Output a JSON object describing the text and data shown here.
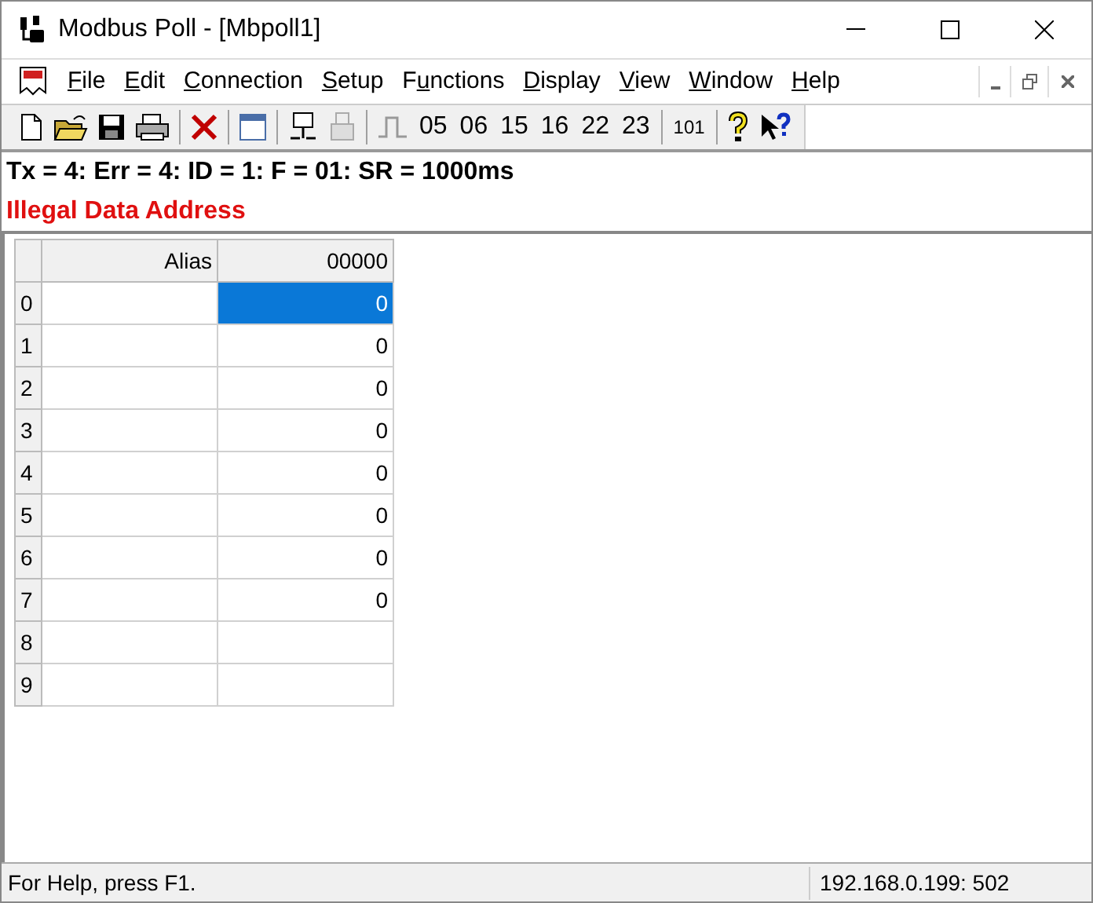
{
  "window": {
    "title": "Modbus Poll - [Mbpoll1]"
  },
  "menu": [
    {
      "access_key": "F",
      "after": "ile"
    },
    {
      "access_key": "E",
      "after": "dit"
    },
    {
      "access_key": "C",
      "after": "onnection"
    },
    {
      "access_key": "S",
      "after": "etup"
    },
    {
      "before": "F",
      "access_key": "u",
      "after": "nctions"
    },
    {
      "access_key": "D",
      "after": "isplay"
    },
    {
      "access_key": "V",
      "after": "iew"
    },
    {
      "access_key": "W",
      "after": "indow"
    },
    {
      "access_key": "H",
      "after": "elp"
    }
  ],
  "toolbar": [
    {
      "kind": "new"
    },
    {
      "kind": "open"
    },
    {
      "kind": "save"
    },
    {
      "kind": "print"
    },
    {
      "kind": "sep"
    },
    {
      "kind": "disconnect"
    },
    {
      "kind": "sep"
    },
    {
      "kind": "window"
    },
    {
      "kind": "sep"
    },
    {
      "kind": "connect"
    },
    {
      "kind": "connect_disabled"
    },
    {
      "kind": "sep"
    },
    {
      "kind": "pulse"
    },
    {
      "kind": "text",
      "label": "05"
    },
    {
      "kind": "text",
      "label": "06"
    },
    {
      "kind": "text",
      "label": "15"
    },
    {
      "kind": "text",
      "label": "16"
    },
    {
      "kind": "text",
      "label": "22"
    },
    {
      "kind": "text",
      "label": "23"
    },
    {
      "kind": "sep"
    },
    {
      "kind": "small_text",
      "label": "101"
    },
    {
      "kind": "sep"
    },
    {
      "kind": "help"
    },
    {
      "kind": "context_help"
    }
  ],
  "status_line": "Tx = 4: Err = 4: ID = 1: F = 01: SR = 1000ms",
  "error_line": "Illegal Data Address",
  "table": {
    "columns": [
      "Alias",
      "00000"
    ],
    "rows": [
      {
        "header": "0",
        "value": "0",
        "selected": true
      },
      {
        "header": "1",
        "value": "0",
        "selected": false
      },
      {
        "header": "2",
        "value": "0",
        "selected": false
      },
      {
        "header": "3",
        "value": "0",
        "selected": false
      },
      {
        "header": "4",
        "value": "0",
        "selected": false
      },
      {
        "header": "5",
        "value": "0",
        "selected": false
      },
      {
        "header": "6",
        "value": "0",
        "selected": false
      },
      {
        "header": "7",
        "value": "0",
        "selected": false
      },
      {
        "header": "8",
        "selected": false
      },
      {
        "header": "9",
        "selected": false
      }
    ]
  },
  "status_bar": {
    "help": "For Help, press F1.",
    "address": "192.168.0.199: 502"
  }
}
